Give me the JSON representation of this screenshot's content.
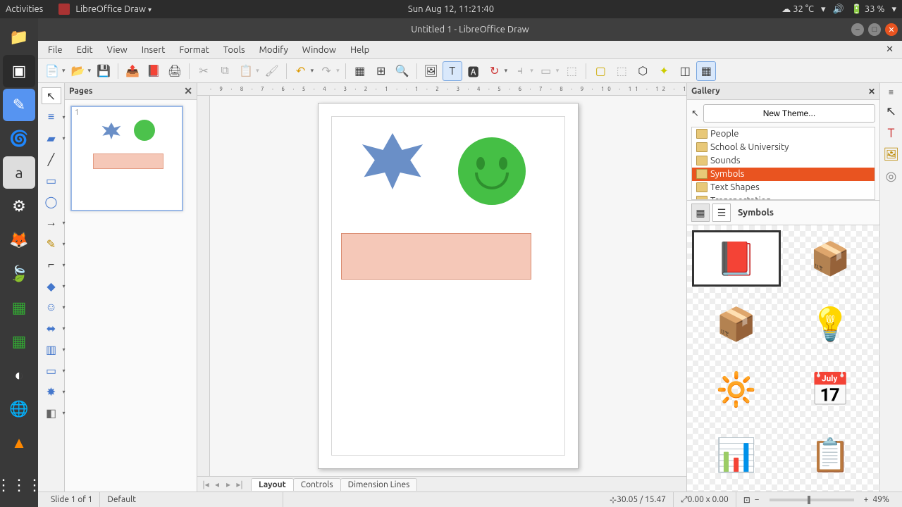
{
  "os": {
    "activities": "Activities",
    "app_label": "LibreOffice Draw",
    "datetime": "Sun Aug 12, 11:21:40",
    "temperature": "32 °C",
    "battery": "33 %"
  },
  "window": {
    "title": "Untitled 1 - LibreOffice Draw"
  },
  "menus": [
    "File",
    "Edit",
    "View",
    "Insert",
    "Format",
    "Tools",
    "Modify",
    "Window",
    "Help"
  ],
  "pages_panel": {
    "title": "Pages"
  },
  "tabs": {
    "nav": [
      "|◂",
      "◂",
      "▸",
      "▸|"
    ],
    "items": [
      "Layout",
      "Controls",
      "Dimension Lines"
    ],
    "active": 0
  },
  "gallery": {
    "title": "Gallery",
    "new_theme": "New Theme...",
    "themes": [
      "People",
      "School & University",
      "Sounds",
      "Symbols",
      "Text Shapes",
      "Transportation"
    ],
    "selected_theme_index": 3,
    "current_label": "Symbols",
    "items": [
      {
        "name": "book",
        "glyph": "📕"
      },
      {
        "name": "open-box",
        "glyph": "📦"
      },
      {
        "name": "closed-box",
        "glyph": "📦"
      },
      {
        "name": "lightbulb",
        "glyph": "💡"
      },
      {
        "name": "bright-bulb",
        "glyph": "🔆"
      },
      {
        "name": "calendar",
        "glyph": "📅"
      },
      {
        "name": "chart",
        "glyph": "📊"
      },
      {
        "name": "clipboard",
        "glyph": "📋"
      }
    ],
    "selected_item": 0
  },
  "status": {
    "slide": "Slide 1 of 1",
    "style": "Default",
    "coords": "30.05 / 15.47",
    "size": "0.00 x 0.00",
    "zoom": "49%"
  }
}
